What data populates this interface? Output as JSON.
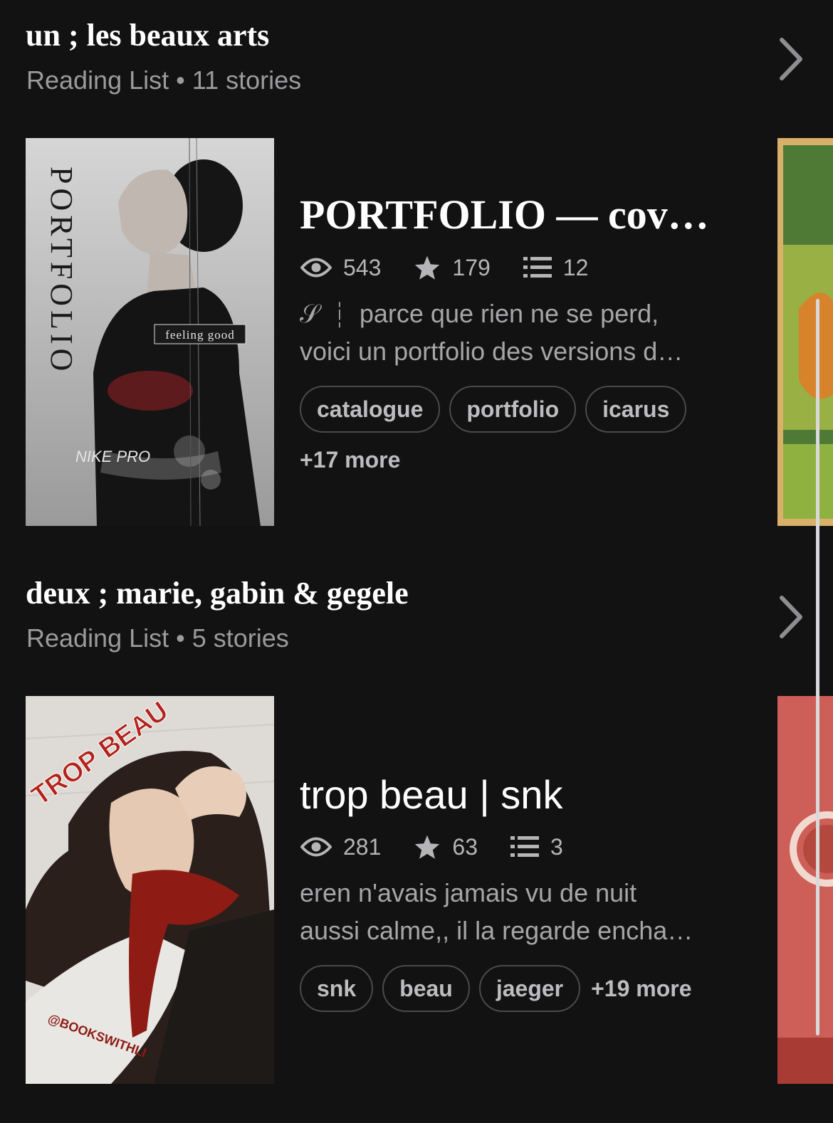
{
  "lists": [
    {
      "title": "un ; les beaux arts",
      "meta": "Reading List • 11 stories",
      "story": {
        "title": "PORTFOLIO — cov…",
        "reads": "543",
        "votes": "179",
        "parts": "12",
        "desc_line1": "𝒮 ┆   parce que rien ne se perd,",
        "desc_line2": "voici un portfolio des versions d…",
        "tags": [
          "catalogue",
          "portfolio",
          "icarus"
        ],
        "more": "+17 more",
        "cover_text": {
          "vertical": "PORTFOLIO",
          "caption": "feeling good",
          "brand": "NIKE PRO"
        }
      }
    },
    {
      "title": "deux ; marie, gabin & gegele",
      "meta": "Reading List • 5 stories",
      "story": {
        "title": "trop beau | snk",
        "reads": "281",
        "votes": "63",
        "parts": "3",
        "desc_line1": "eren n'avais jamais vu de nuit",
        "desc_line2": "aussi calme,, il la regarde encha…",
        "tags": [
          "snk",
          "beau",
          "jaeger"
        ],
        "more": "+19 more",
        "cover_text": {
          "title": "TROP BEAU",
          "handle": "@BOOKSWITHLI"
        }
      }
    }
  ],
  "icons": {
    "reads": "eye-icon",
    "votes": "star-icon",
    "parts": "list-icon",
    "open": "chevron-right-icon"
  },
  "colors": {
    "background": "#121213",
    "muted_text": "#9b9b9d",
    "tag_border": "#4a4a4c"
  }
}
